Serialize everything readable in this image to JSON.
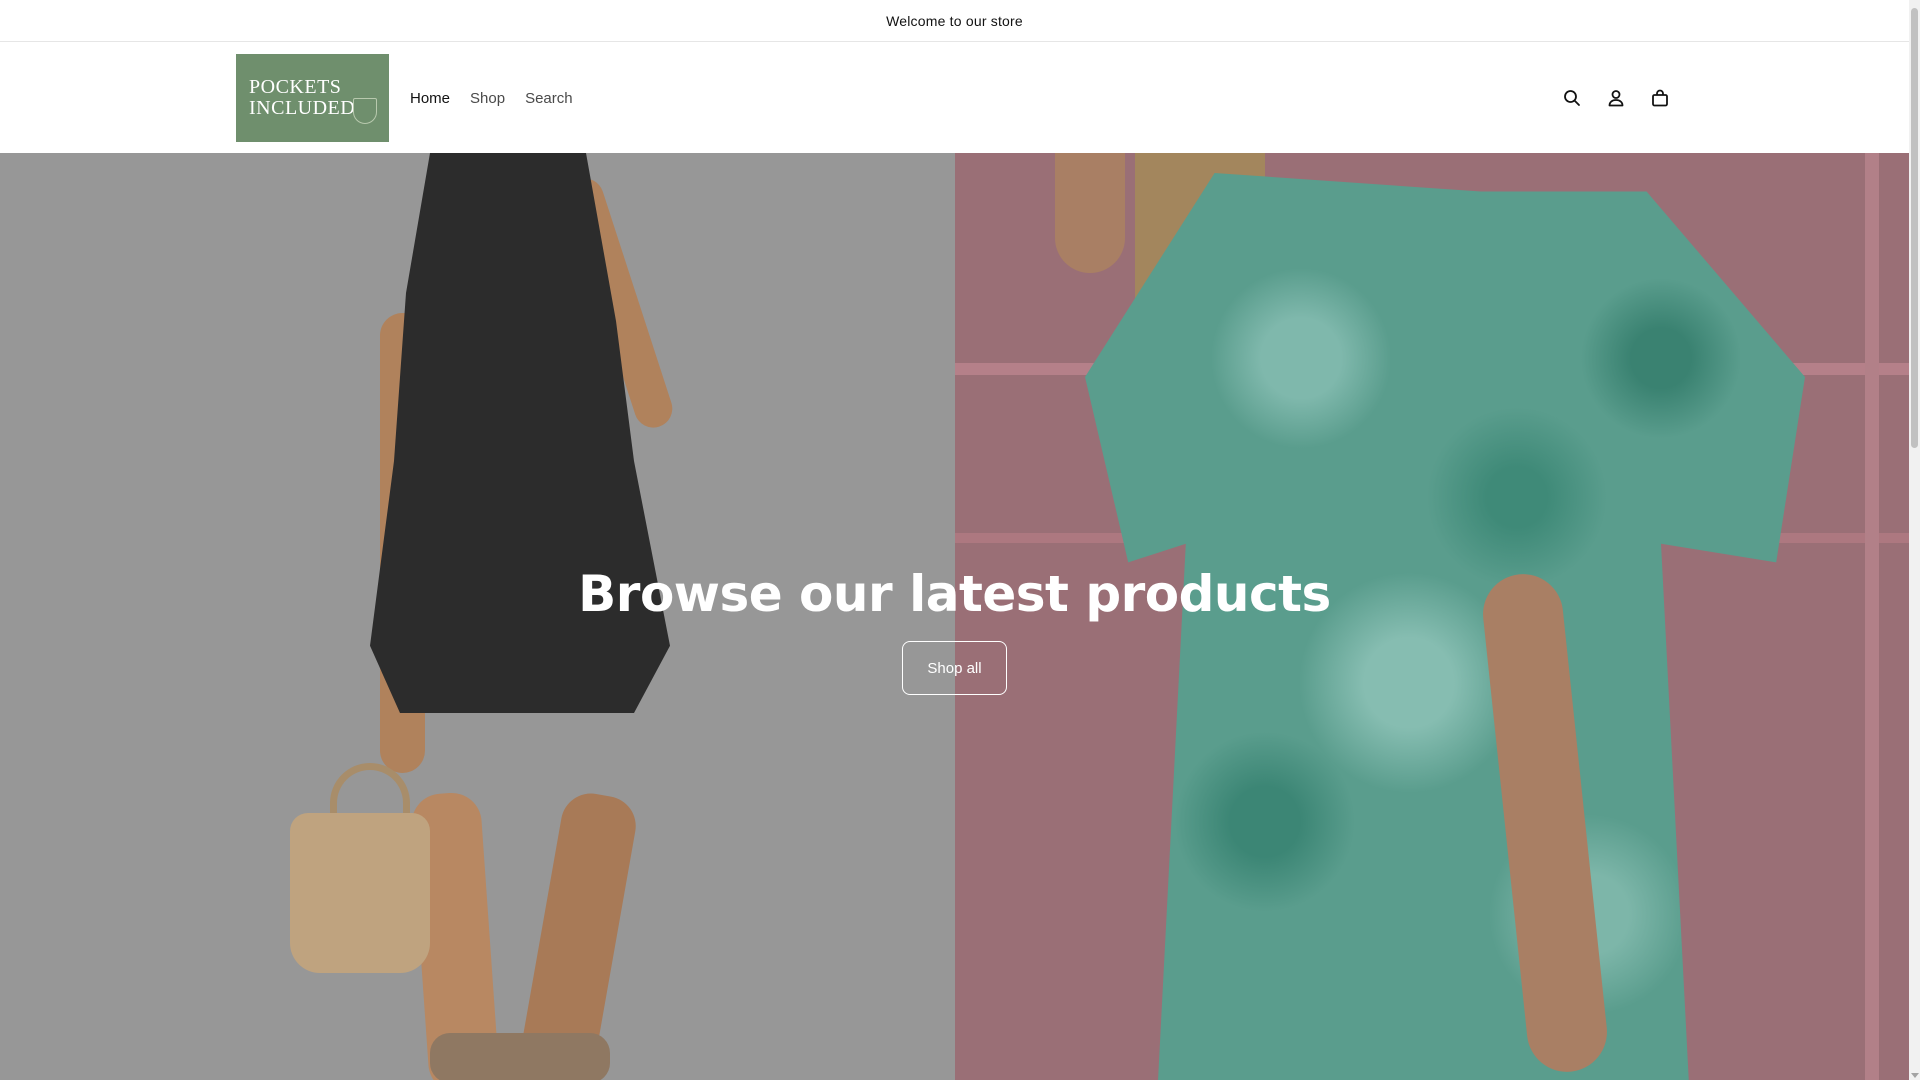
{
  "announcement": {
    "text": "Welcome to our store"
  },
  "header": {
    "logo": {
      "line1": "POCKETS",
      "line2": "INCLUDED",
      "color": "#6f8f6d"
    },
    "nav": [
      {
        "label": "Home",
        "active": true
      },
      {
        "label": "Shop",
        "active": false
      },
      {
        "label": "Search",
        "active": false
      }
    ],
    "icons": [
      "search-icon",
      "account-icon",
      "cart-icon"
    ]
  },
  "hero": {
    "title": "Browse our latest products",
    "button_label": "Shop all"
  }
}
